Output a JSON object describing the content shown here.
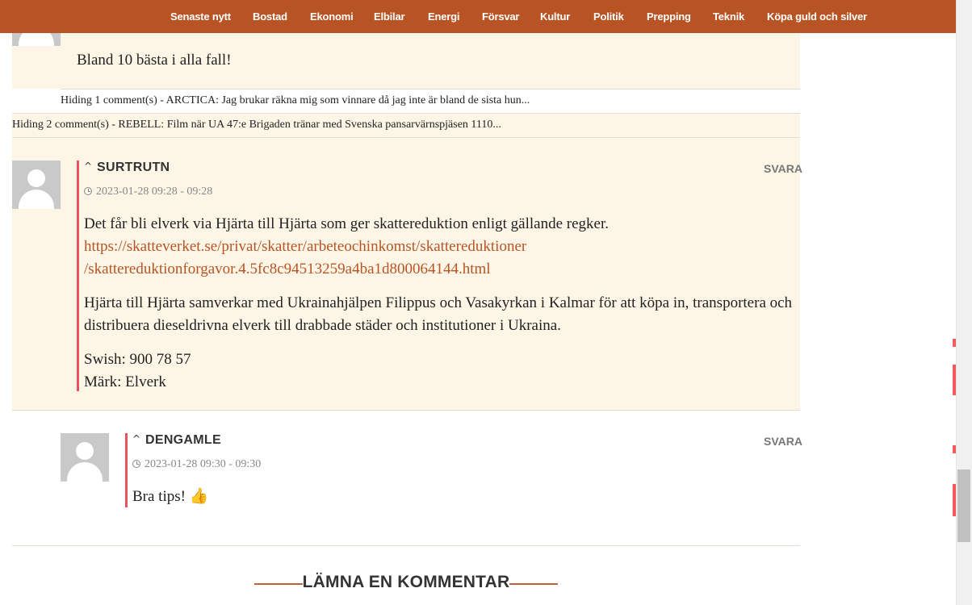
{
  "nav": {
    "items": [
      "Senaste nytt",
      "Bostad",
      "Ekonomi",
      "Elbilar",
      "Energi",
      "Försvar",
      "Kultur",
      "Politik",
      "Prepping",
      "Teknik",
      "Köpa guld och silver"
    ]
  },
  "partial_comment": {
    "text": "Bland 10 bästa i alla fall!"
  },
  "hidden1": "Hiding 1 comment(s) - ARCTICA: Jag brukar räkna mig som vinnare då jag inte är bland de sista hun...",
  "hidden2": "Hiding 2 comment(s) - REBELL: Film när UA 47:e Brigaden tränar med Svenska pansarvärnspjäsen 1110...",
  "comment1": {
    "author": "SURTRUTN",
    "reply": "SVARA",
    "datetime": "2023-01-28 09:28 - 09:28",
    "para1": "Det får bli elverk via Hjärta till Hjärta som ger skattereduktion enligt gällande regker.",
    "link_line1": "https://skatteverket.se/privat/skatter/arbeteochinkomst/skattereduktioner",
    "link_line2": "/skattereduktionforgavor.4.5fc8c94513259a4ba1d800064144.html",
    "para2": "Hjärta till Hjärta samverkar med Ukrainahjälpen Filippus och Vasakyrkan i Kalmar för att köpa in, transportera och distribuera dieseldrivna elverk till drabbade städer och institutioner i Ukraina.",
    "swish": "Swish: 900 78 57",
    "mark": "Märk: Elverk"
  },
  "comment2": {
    "author": "DENGAMLE",
    "reply": "SVARA",
    "datetime": "2023-01-28 09:30 - 09:30",
    "text": "Bra tips! 👍"
  },
  "leave_comment_title": "LÄMNA EN KOMMENTAR",
  "colors": {
    "nav_bg": "#b85424",
    "comment_bg": "#fdf6e7",
    "accent_bar": "#e7525b",
    "link": "#b85424"
  }
}
